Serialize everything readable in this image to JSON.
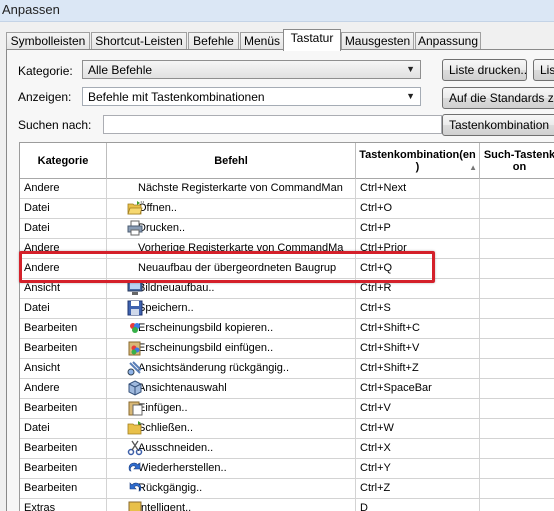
{
  "window": {
    "title": "Anpassen"
  },
  "tabs": [
    {
      "label": "Symbolleisten",
      "active": false
    },
    {
      "label": "Shortcut-Leisten",
      "active": false
    },
    {
      "label": "Befehle",
      "active": false
    },
    {
      "label": "Menüs",
      "active": false
    },
    {
      "label": "Tastatur",
      "active": true
    },
    {
      "label": "Mausgesten",
      "active": false
    },
    {
      "label": "Anpassung",
      "active": false
    }
  ],
  "filters": {
    "category_label": "Kategorie:",
    "category_value": "Alle Befehle",
    "show_label": "Anzeigen:",
    "show_value": "Befehle mit Tastenkombinationen",
    "search_label": "Suchen nach:",
    "search_value": ""
  },
  "buttons": {
    "print_list": "Liste drucken...",
    "list": "Liste",
    "defaults": "Auf die Standards zu",
    "key_combo": "Tastenkombination"
  },
  "table": {
    "columns": {
      "category": "Kategorie",
      "command": "Befehl",
      "shortcut_line1": "Tastenkombination(en",
      "shortcut_line2": ")",
      "search_shortcut_line1": "Such-Tastenk",
      "search_shortcut_line2": "on"
    },
    "rows": [
      {
        "category": "Andere",
        "command": "Nächste Registerkarte von CommandMan",
        "shortcut": "Ctrl+Next",
        "icon": "none"
      },
      {
        "category": "Datei",
        "command": "Öffnen..",
        "shortcut": "Ctrl+O",
        "icon": "open-folder-icon"
      },
      {
        "category": "Datei",
        "command": "Drucken..",
        "shortcut": "Ctrl+P",
        "icon": "printer-icon"
      },
      {
        "category": "Andere",
        "command": "Vorherige Registerkarte von CommandMa",
        "shortcut": "Ctrl+Prior",
        "icon": "none"
      },
      {
        "category": "Andere",
        "command": "Neuaufbau der übergeordneten Baugrup",
        "shortcut": "Ctrl+Q",
        "icon": "none"
      },
      {
        "category": "Ansicht",
        "command": "Bildneuaufbau..",
        "shortcut": "Ctrl+R",
        "icon": "monitor-icon"
      },
      {
        "category": "Datei",
        "command": "Speichern..",
        "shortcut": "Ctrl+S",
        "icon": "save-icon"
      },
      {
        "category": "Bearbeiten",
        "command": "Erscheinungsbild kopieren..",
        "shortcut": "Ctrl+Shift+C",
        "icon": "copy-appearance-icon"
      },
      {
        "category": "Bearbeiten",
        "command": "Erscheinungsbild einfügen..",
        "shortcut": "Ctrl+Shift+V",
        "icon": "paste-appearance-icon"
      },
      {
        "category": "Ansicht",
        "command": "Ansichtsänderung rückgängig..",
        "shortcut": "Ctrl+Shift+Z",
        "icon": "undo-view-icon"
      },
      {
        "category": "Andere",
        "command": "Ansichtenauswahl",
        "shortcut": "Ctrl+SpaceBar",
        "icon": "view-selector-icon"
      },
      {
        "category": "Bearbeiten",
        "command": "Einfügen..",
        "shortcut": "Ctrl+V",
        "icon": "paste-icon"
      },
      {
        "category": "Datei",
        "command": "Schließen..",
        "shortcut": "Ctrl+W",
        "icon": "close-folder-icon"
      },
      {
        "category": "Bearbeiten",
        "command": "Ausschneiden..",
        "shortcut": "Ctrl+X",
        "icon": "scissors-icon"
      },
      {
        "category": "Bearbeiten",
        "command": "Wiederherstellen..",
        "shortcut": "Ctrl+Y",
        "icon": "redo-icon"
      },
      {
        "category": "Bearbeiten",
        "command": "Rückgängig..",
        "shortcut": "Ctrl+Z",
        "icon": "undo-icon"
      },
      {
        "category": "Extras",
        "command": "Intelligent..",
        "shortcut": "D",
        "icon": "smart-icon"
      }
    ]
  },
  "highlighted_row_index": 4,
  "colors": {
    "highlight": "#d4202a",
    "tab_panel": "#f7f7f7"
  }
}
